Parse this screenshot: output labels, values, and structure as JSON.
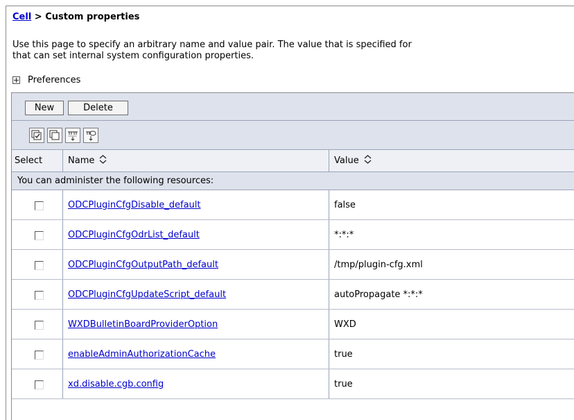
{
  "breadcrumb": {
    "link": "Cell",
    "separator": " > ",
    "current": "Custom properties"
  },
  "description": {
    "line1": "Use this page to specify an arbitrary name and value pair. The value that is specified for",
    "line2": "that can set internal system configuration properties."
  },
  "preferences": {
    "label": "Preferences"
  },
  "buttons": {
    "new": "New",
    "delete": "Delete"
  },
  "icons": [
    "select-all-icon",
    "deselect-all-icon",
    "show-filter-icon",
    "clear-filter-icon"
  ],
  "table": {
    "columns": {
      "select": "Select",
      "name": "Name",
      "value": "Value"
    },
    "group_label": "You can administer the following resources:",
    "rows": [
      {
        "name": "ODCPluginCfgDisable_default",
        "value": "false"
      },
      {
        "name": "ODCPluginCfgOdrList_default",
        "value": "*:*:*"
      },
      {
        "name": "ODCPluginCfgOutputPath_default",
        "value": "/tmp/plugin-cfg.xml"
      },
      {
        "name": "ODCPluginCfgUpdateScript_default",
        "value": "autoPropagate *:*:*"
      },
      {
        "name": "WXDBulletinBoardProviderOption",
        "value": "WXD"
      },
      {
        "name": "enableAdminAuthorizationCache",
        "value": "true"
      },
      {
        "name": "xd.disable.cgb.config",
        "value": "true"
      }
    ]
  },
  "colors": {
    "link": "#0000cc",
    "toolbar_bg": "#dde2ec",
    "header_bg": "#eef0f5"
  }
}
